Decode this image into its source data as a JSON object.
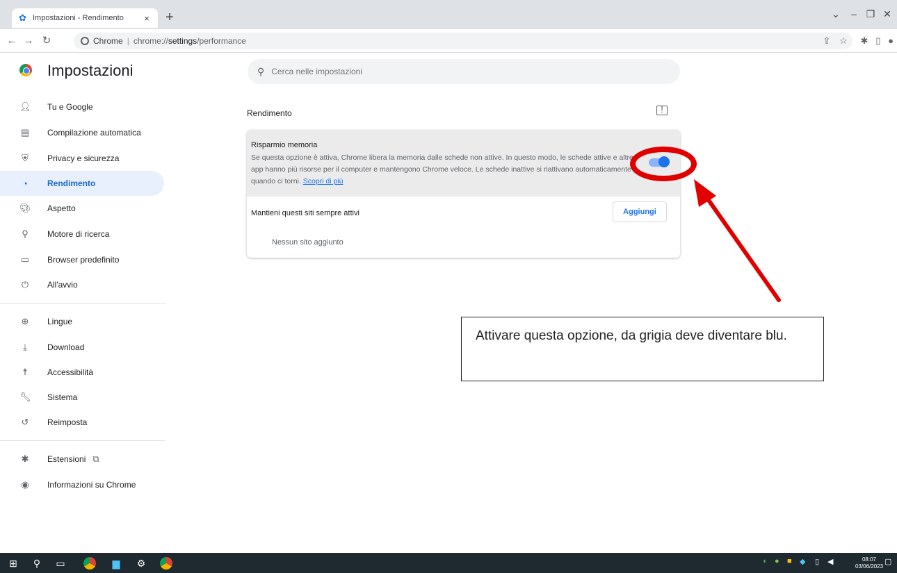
{
  "browser": {
    "tab_title": "Impostazioni - Rendimento",
    "tab_close": "×",
    "new_tab": "+",
    "site_chip": "Chrome",
    "url_scheme": "chrome://",
    "url_bold": "settings",
    "url_rest": "/performance"
  },
  "settings": {
    "title": "Impostazioni",
    "search_placeholder": "Cerca nelle impostazioni"
  },
  "sidebar": {
    "items": [
      {
        "label": "Tu e Google",
        "icon": "person-icon"
      },
      {
        "label": "Compilazione automatica",
        "icon": "clipboard-icon"
      },
      {
        "label": "Privacy e sicurezza",
        "icon": "shield-icon"
      },
      {
        "label": "Rendimento",
        "icon": "speedometer-icon",
        "active": true
      },
      {
        "label": "Aspetto",
        "icon": "palette-icon"
      },
      {
        "label": "Motore di ricerca",
        "icon": "search-icon"
      },
      {
        "label": "Browser predefinito",
        "icon": "browser-icon"
      },
      {
        "label": "All'avvio",
        "icon": "power-icon"
      },
      {
        "label": "Lingue",
        "icon": "globe-icon"
      },
      {
        "label": "Download",
        "icon": "download-icon"
      },
      {
        "label": "Accessibilità",
        "icon": "accessibility-icon"
      },
      {
        "label": "Sistema",
        "icon": "wrench-icon"
      },
      {
        "label": "Reimposta",
        "icon": "restore-icon"
      },
      {
        "label": "Estensioni",
        "icon": "puzzle-icon"
      },
      {
        "label": "Informazioni su Chrome",
        "icon": "chrome-icon"
      }
    ]
  },
  "main": {
    "section_title": "Rendimento",
    "memory_saver": {
      "title": "Risparmio memoria",
      "description": "Se questa opzione è attiva, Chrome libera la memoria dalle schede non attive. In questo modo, le schede attive e altre app hanno più risorse per il computer e mantengono Chrome veloce. Le schede inattive si riattivano automaticamente quando ci torni.",
      "learn_more": "Scopri di più",
      "enabled": true
    },
    "always_active": {
      "label": "Mantieni questi siti sempre attivi",
      "add_button": "Aggiungi",
      "empty_text": "Nessun sito aggiunto"
    }
  },
  "annotation": {
    "note": "Attivare questa opzione, da grigia deve diventare blu.",
    "color": "#e00000"
  },
  "taskbar": {
    "time": "08:07",
    "date": "03/06/2023"
  },
  "colors": {
    "accent": "#1a73e8",
    "active_nav_bg": "#e8f0fe",
    "card_highlight": "#ebebeb"
  }
}
